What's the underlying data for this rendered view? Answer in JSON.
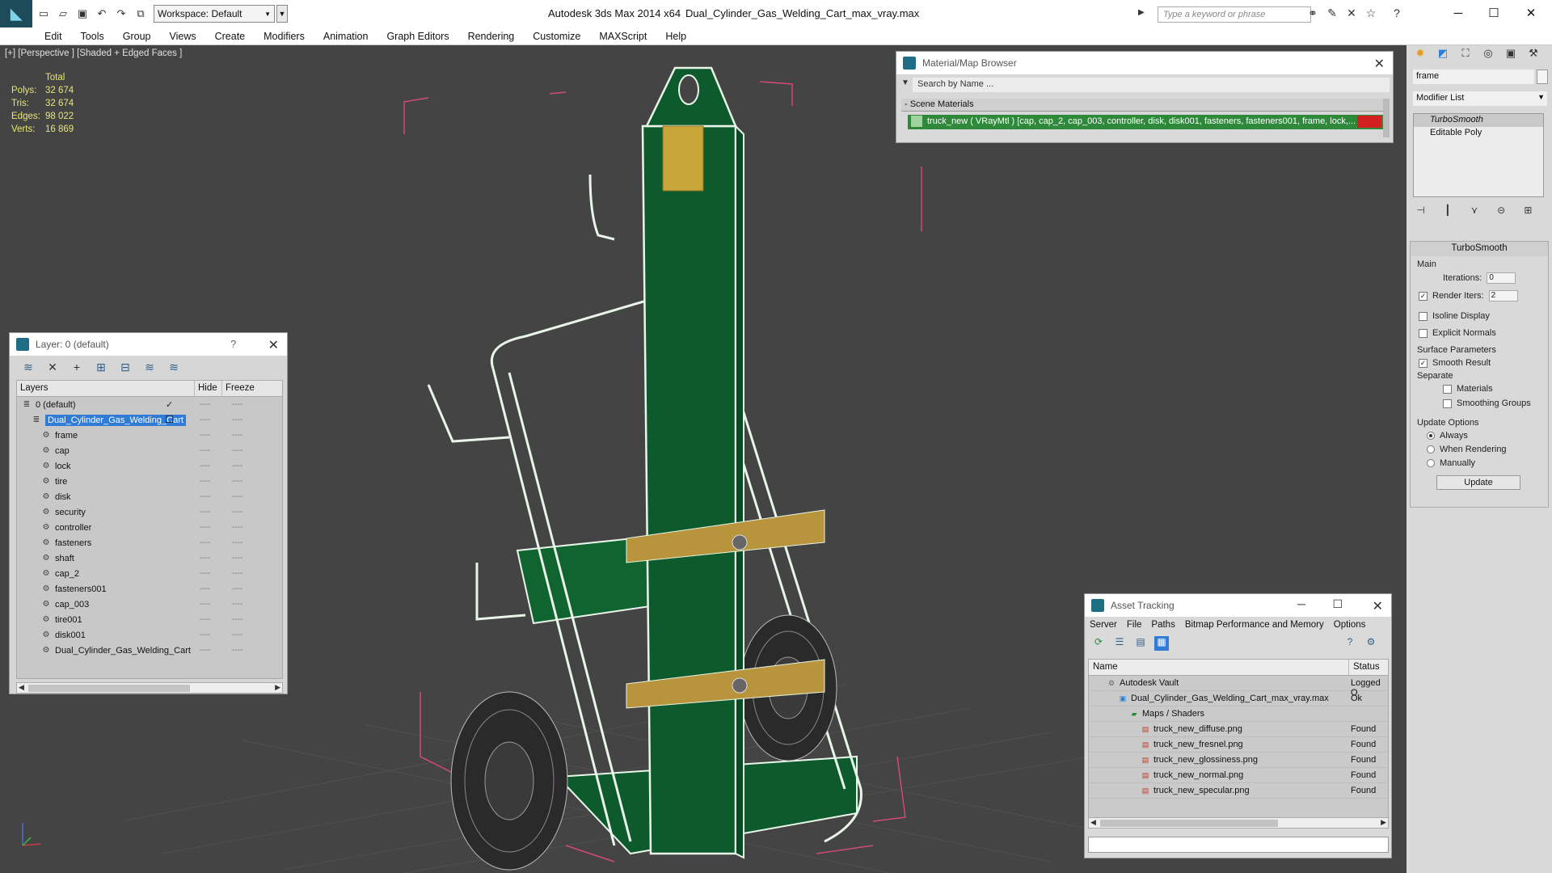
{
  "titlebar": {
    "workspace": "Workspace: Default",
    "app_title": "Autodesk 3ds Max  2014 x64",
    "file_title": "Dual_Cylinder_Gas_Welding_Cart_max_vray.max",
    "search_placeholder": "Type a keyword or phrase"
  },
  "menu": [
    "Edit",
    "Tools",
    "Group",
    "Views",
    "Create",
    "Modifiers",
    "Animation",
    "Graph Editors",
    "Rendering",
    "Customize",
    "MAXScript",
    "Help"
  ],
  "viewport": {
    "label": "[+] [Perspective ] [Shaded + Edged Faces ]",
    "stats_header": "Total",
    "stats": [
      {
        "label": "Polys:",
        "value": "32 674"
      },
      {
        "label": "Tris:",
        "value": "32 674"
      },
      {
        "label": "Edges:",
        "value": "98 022"
      },
      {
        "label": "Verts:",
        "value": "16 869"
      }
    ]
  },
  "layer_panel": {
    "title": "Layer: 0 (default)",
    "help": "?",
    "col_layers": "Layers",
    "col_hide": "Hide",
    "col_freeze": "Freeze",
    "rows": [
      {
        "name": "0 (default)",
        "indent": 0,
        "check": "✓"
      },
      {
        "name": "Dual_Cylinder_Gas_Welding_Cart",
        "indent": 1,
        "selected": true
      },
      {
        "name": "frame",
        "indent": 2
      },
      {
        "name": "cap",
        "indent": 2
      },
      {
        "name": "lock",
        "indent": 2
      },
      {
        "name": "tire",
        "indent": 2
      },
      {
        "name": "disk",
        "indent": 2
      },
      {
        "name": "security",
        "indent": 2
      },
      {
        "name": "controller",
        "indent": 2
      },
      {
        "name": "fasteners",
        "indent": 2
      },
      {
        "name": "shaft",
        "indent": 2
      },
      {
        "name": "cap_2",
        "indent": 2
      },
      {
        "name": "fasteners001",
        "indent": 2
      },
      {
        "name": "cap_003",
        "indent": 2
      },
      {
        "name": "tire001",
        "indent": 2
      },
      {
        "name": "disk001",
        "indent": 2
      },
      {
        "name": "Dual_Cylinder_Gas_Welding_Cart",
        "indent": 2
      }
    ],
    "dash": "----"
  },
  "material_browser": {
    "title": "Material/Map Browser",
    "search_placeholder": "Search by Name ...",
    "section": "- Scene Materials",
    "material_row": "truck_new  ( VRayMtl )  [cap, cap_2, cap_003, controller, disk, disk001, fasteners, fasteners001, frame, lock,..."
  },
  "command_panel": {
    "object_name": "frame",
    "modifier_list": "Modifier List",
    "stack": [
      "TurboSmooth",
      "Editable Poly"
    ],
    "rollout_title": "TurboSmooth",
    "main_label": "Main",
    "iterations_label": "Iterations:",
    "iterations_value": "0",
    "render_iters_label": "Render Iters:",
    "render_iters_value": "2",
    "isoline": "Isoline Display",
    "explicit_normals": "Explicit Normals",
    "surface_params": "Surface Parameters",
    "smooth_result": "Smooth Result",
    "separate": "Separate",
    "materials": "Materials",
    "smoothing_groups": "Smoothing Groups",
    "update_options": "Update Options",
    "always": "Always",
    "when_rendering": "When Rendering",
    "manually": "Manually",
    "update_button": "Update"
  },
  "asset_tracking": {
    "title": "Asset Tracking",
    "menu": [
      "Server",
      "File",
      "Paths",
      "Bitmap Performance and Memory",
      "Options"
    ],
    "col_name": "Name",
    "col_status": "Status",
    "rows": [
      {
        "name": "Autodesk Vault",
        "status": "Logged O",
        "indent": 1,
        "icon": "vault"
      },
      {
        "name": "Dual_Cylinder_Gas_Welding_Cart_max_vray.max",
        "status": "Ok",
        "indent": 2,
        "icon": "max"
      },
      {
        "name": "Maps / Shaders",
        "status": "",
        "indent": 3,
        "icon": "maps"
      },
      {
        "name": "truck_new_diffuse.png",
        "status": "Found",
        "indent": 4,
        "icon": "png"
      },
      {
        "name": "truck_new_fresnel.png",
        "status": "Found",
        "indent": 4,
        "icon": "png"
      },
      {
        "name": "truck_new_glossiness.png",
        "status": "Found",
        "indent": 4,
        "icon": "png"
      },
      {
        "name": "truck_new_normal.png",
        "status": "Found",
        "indent": 4,
        "icon": "png"
      },
      {
        "name": "truck_new_specular.png",
        "status": "Found",
        "indent": 4,
        "icon": "png"
      }
    ]
  },
  "colors": {
    "viewport_bg": "#444444",
    "stats_yellow": "#e8e870",
    "cart_green": "#0d5a2c",
    "wire_white": "#e8f5e8",
    "strap_tan": "#b8953c",
    "bbox_pink": "#d14a78"
  }
}
